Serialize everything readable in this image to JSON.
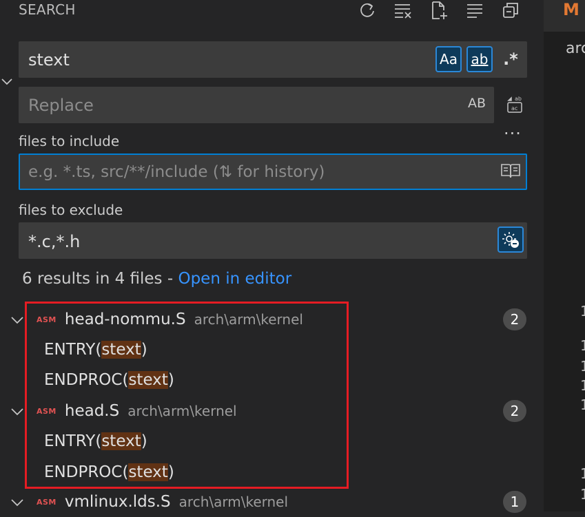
{
  "header": {
    "title": "SEARCH",
    "toolbar_icons": [
      "refresh-icon",
      "clear-results-icon",
      "new-search-editor-icon",
      "view-as-tree-icon",
      "collapse-all-icon"
    ]
  },
  "editor": {
    "tab_letter": "M",
    "text": "arc"
  },
  "search": {
    "value": "stext",
    "match_case_label": "Aa",
    "whole_word_label": "ab",
    "regex_label": ".*"
  },
  "replace": {
    "placeholder": "Replace",
    "preserve_case_label": "AB"
  },
  "include": {
    "label": "files to include",
    "placeholder": "e.g. *.ts, src/**/include (⇅ for history)"
  },
  "exclude": {
    "label": "files to exclude",
    "value": "*.c,*.h"
  },
  "summary": {
    "text": "6 results in 4 files - ",
    "link": "Open in editor"
  },
  "files": [
    {
      "icon": "ASM",
      "name": "head-nommu.S",
      "path": "arch\\arm\\kernel",
      "count": "2"
    },
    {
      "icon": "ASM",
      "name": "head.S",
      "path": "arch\\arm\\kernel",
      "count": "2"
    },
    {
      "icon": "ASM",
      "name": "vmlinux.lds.S",
      "path": "arch\\arm\\kernel",
      "count": "1"
    }
  ],
  "matches": [
    {
      "before": "ENTRY(",
      "hit": "stext",
      "after": ")"
    },
    {
      "before": "ENDPROC(",
      "hit": "stext",
      "after": ")"
    },
    {
      "before": "ENTRY(",
      "hit": "stext",
      "after": ")"
    },
    {
      "before": "ENDPROC(",
      "hit": "stext",
      "after": ")"
    }
  ],
  "colors": {
    "background": "#252526",
    "input": "#3c3c3c",
    "focus_border": "#007fd4",
    "link": "#3794ff",
    "highlight": "#613214",
    "annotation_box": "#e51c23"
  }
}
